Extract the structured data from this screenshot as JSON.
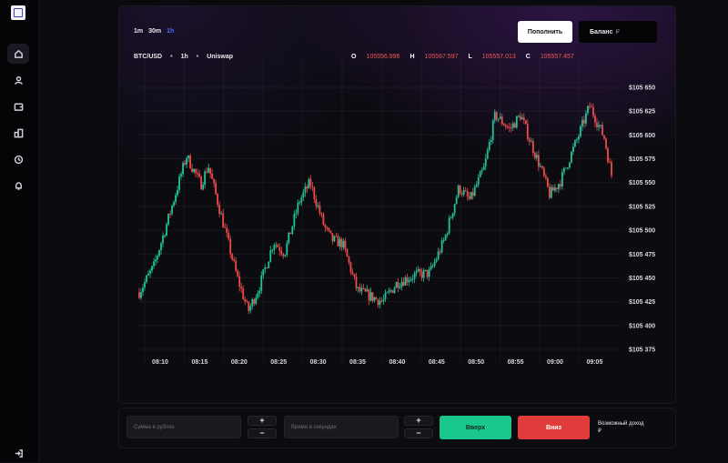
{
  "sidebar": {
    "items": [
      {
        "icon": "home-icon",
        "active": true
      },
      {
        "icon": "user-icon",
        "active": false
      },
      {
        "icon": "wallet-icon",
        "active": false
      },
      {
        "icon": "building-icon",
        "active": false
      },
      {
        "icon": "clock-icon",
        "active": false
      },
      {
        "icon": "bell-icon",
        "active": false
      }
    ],
    "logout_icon": "logout-icon"
  },
  "header": {
    "timeframes": [
      "1m",
      "30m",
      "1h"
    ],
    "active_timeframe": "1h",
    "pair": "BTC/USD",
    "interval": "1h",
    "source": "Uniswap",
    "separator": "•",
    "ohlc": {
      "o_label": "O",
      "o_value": "105556.996",
      "h_label": "H",
      "h_value": "105567.597",
      "l_label": "L",
      "l_value": "105557.013",
      "c_label": "C",
      "c_value": "105557.457"
    },
    "topup_label": "Пополнить",
    "balance_label": "Баланс",
    "balance_currency": "₽"
  },
  "chart_data": {
    "type": "candlestick",
    "up_color": "#22c39a",
    "down_color": "#ef4b4b",
    "x_ticks": [
      "08:10",
      "08:15",
      "08:20",
      "08:25",
      "08:30",
      "08:35",
      "08:40",
      "08:45",
      "08:50",
      "08:55",
      "09:00",
      "09:05"
    ],
    "y_ticks": [
      "$105 650",
      "$105 625",
      "$105 600",
      "$105 575",
      "$105 550",
      "$105 525",
      "$105 500",
      "$105 475",
      "$105 450",
      "$105 425",
      "$105 400",
      "$105 375"
    ],
    "ylim": [
      105375,
      105650
    ],
    "path_points": [
      [
        0,
        105435
      ],
      [
        4,
        105462
      ],
      [
        8,
        105512
      ],
      [
        13,
        105578
      ],
      [
        17,
        105548
      ],
      [
        19,
        105568
      ],
      [
        27,
        105450
      ],
      [
        30,
        105415
      ],
      [
        33,
        105440
      ],
      [
        37,
        105488
      ],
      [
        40,
        105476
      ],
      [
        44,
        105530
      ],
      [
        47,
        105550
      ],
      [
        51,
        105503
      ],
      [
        53,
        105490
      ],
      [
        56,
        105486
      ],
      [
        60,
        105437
      ],
      [
        64,
        105430
      ],
      [
        67,
        105425
      ],
      [
        71,
        105445
      ],
      [
        76,
        105453
      ],
      [
        80,
        105455
      ],
      [
        84,
        105490
      ],
      [
        88,
        105545
      ],
      [
        91,
        105531
      ],
      [
        95,
        105566
      ],
      [
        98,
        105621
      ],
      [
        102,
        105606
      ],
      [
        105,
        105621
      ],
      [
        107,
        105600
      ],
      [
        111,
        105560
      ],
      [
        113,
        105537
      ],
      [
        116,
        105552
      ],
      [
        121,
        105600
      ],
      [
        124,
        105631
      ],
      [
        128,
        105597
      ],
      [
        130,
        105558
      ]
    ]
  },
  "controls": {
    "amount_placeholder": "Сумма в рублях",
    "time_placeholder": "Время в секундах",
    "plus": "+",
    "minus": "−",
    "up_label": "Вверх",
    "down_label": "Вниз",
    "income_label": "Возможный доход",
    "income_currency": "₽"
  }
}
